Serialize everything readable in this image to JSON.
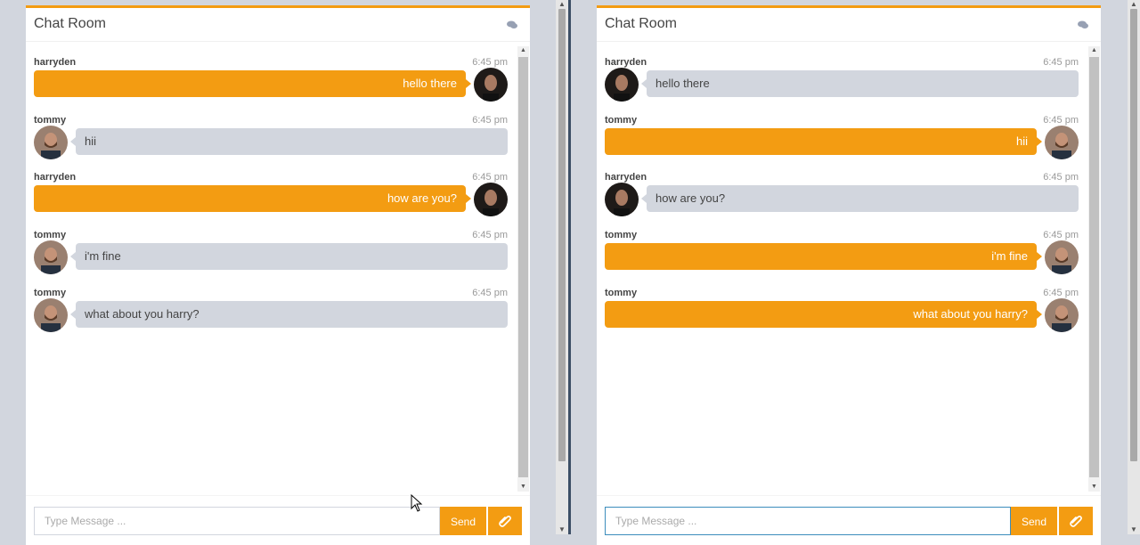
{
  "colors": {
    "accent": "#f39c12",
    "other_bubble": "#d2d6de",
    "background": "#d2d6de"
  },
  "left_panel": {
    "title": "Chat Room",
    "header_icon": "comments-icon",
    "messages": [
      {
        "name": "harryden",
        "time": "6:45 pm",
        "text": "hello there",
        "side": "me",
        "avatar": "avatar-harryden"
      },
      {
        "name": "tommy",
        "time": "6:45 pm",
        "text": "hii",
        "side": "other",
        "avatar": "avatar-tommy"
      },
      {
        "name": "harryden",
        "time": "6:45 pm",
        "text": "how are you?",
        "side": "me",
        "avatar": "avatar-harryden"
      },
      {
        "name": "tommy",
        "time": "6:45 pm",
        "text": "i'm fine",
        "side": "other",
        "avatar": "avatar-tommy"
      },
      {
        "name": "tommy",
        "time": "6:45 pm",
        "text": "what about you harry?",
        "side": "other",
        "avatar": "avatar-tommy"
      }
    ],
    "input_placeholder": "Type Message ...",
    "send_label": "Send",
    "attach_icon": "paperclip-icon"
  },
  "right_panel": {
    "title": "Chat Room",
    "header_icon": "comments-icon",
    "messages": [
      {
        "name": "harryden",
        "time": "6:45 pm",
        "text": "hello there",
        "side": "other",
        "avatar": "avatar-harryden"
      },
      {
        "name": "tommy",
        "time": "6:45 pm",
        "text": "hii",
        "side": "me",
        "avatar": "avatar-tommy"
      },
      {
        "name": "harryden",
        "time": "6:45 pm",
        "text": "how are you?",
        "side": "other",
        "avatar": "avatar-harryden"
      },
      {
        "name": "tommy",
        "time": "6:45 pm",
        "text": "i'm fine",
        "side": "me",
        "avatar": "avatar-tommy"
      },
      {
        "name": "tommy",
        "time": "6:45 pm",
        "text": "what about you harry?",
        "side": "me",
        "avatar": "avatar-tommy"
      }
    ],
    "input_placeholder": "Type Message ...",
    "send_label": "Send",
    "attach_icon": "paperclip-icon"
  }
}
